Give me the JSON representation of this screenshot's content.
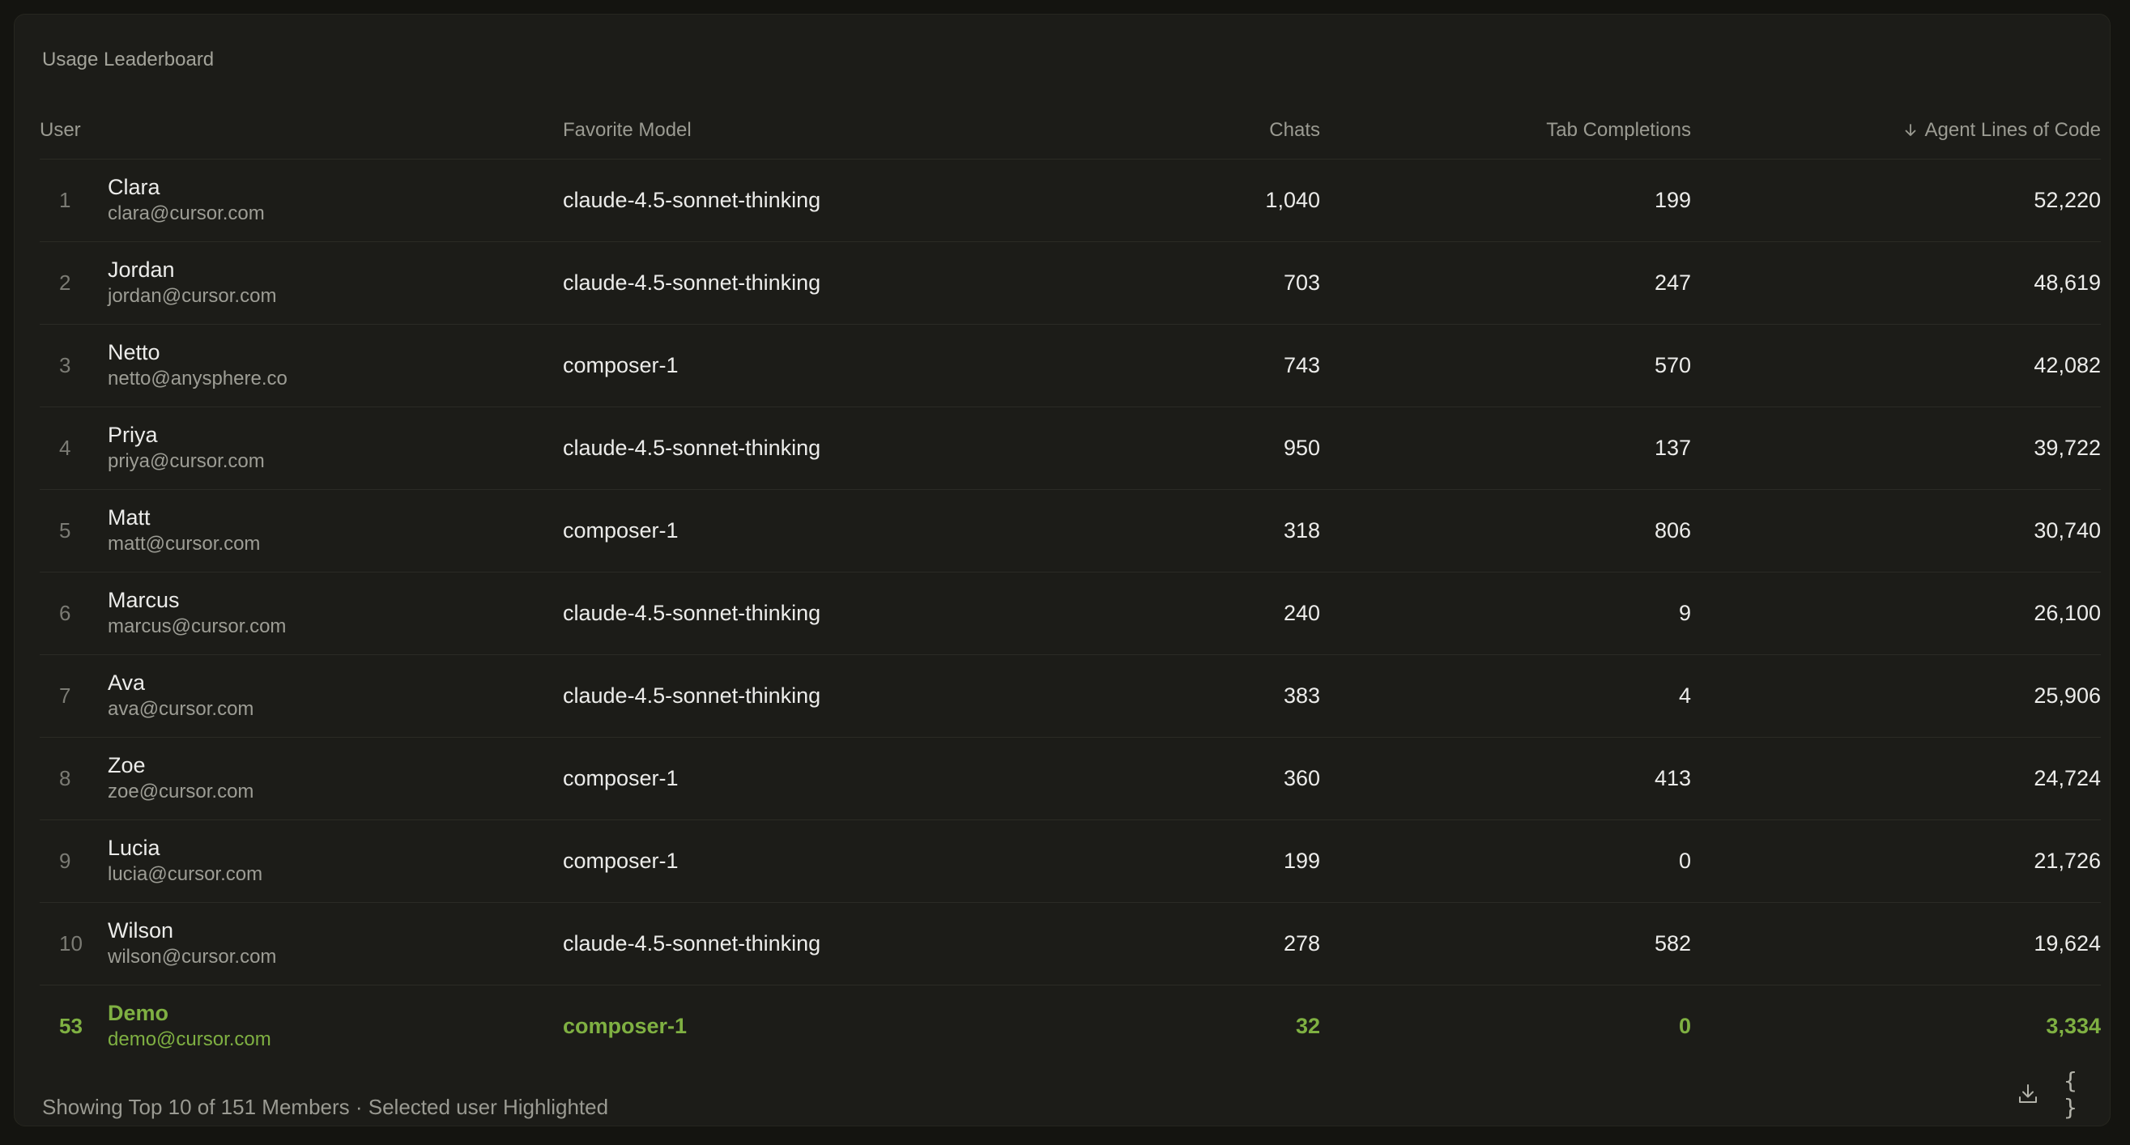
{
  "panel": {
    "title": "Usage Leaderboard"
  },
  "table": {
    "headers": {
      "user": "User",
      "model": "Favorite Model",
      "chats": "Chats",
      "tabs": "Tab Completions",
      "lines": "Agent Lines of Code"
    },
    "sort_icon": "arrow-down-icon",
    "rows": [
      {
        "rank": "1",
        "name": "Clara",
        "email": "clara@cursor.com",
        "model": "claude-4.5-sonnet-thinking",
        "chats": "1,040",
        "tabs": "199",
        "lines": "52,220"
      },
      {
        "rank": "2",
        "name": "Jordan",
        "email": "jordan@cursor.com",
        "model": "claude-4.5-sonnet-thinking",
        "chats": "703",
        "tabs": "247",
        "lines": "48,619"
      },
      {
        "rank": "3",
        "name": "Netto",
        "email": "netto@anysphere.co",
        "model": "composer-1",
        "chats": "743",
        "tabs": "570",
        "lines": "42,082"
      },
      {
        "rank": "4",
        "name": "Priya",
        "email": "priya@cursor.com",
        "model": "claude-4.5-sonnet-thinking",
        "chats": "950",
        "tabs": "137",
        "lines": "39,722"
      },
      {
        "rank": "5",
        "name": "Matt",
        "email": "matt@cursor.com",
        "model": "composer-1",
        "chats": "318",
        "tabs": "806",
        "lines": "30,740"
      },
      {
        "rank": "6",
        "name": "Marcus",
        "email": "marcus@cursor.com",
        "model": "claude-4.5-sonnet-thinking",
        "chats": "240",
        "tabs": "9",
        "lines": "26,100"
      },
      {
        "rank": "7",
        "name": "Ava",
        "email": "ava@cursor.com",
        "model": "claude-4.5-sonnet-thinking",
        "chats": "383",
        "tabs": "4",
        "lines": "25,906"
      },
      {
        "rank": "8",
        "name": "Zoe",
        "email": "zoe@cursor.com",
        "model": "composer-1",
        "chats": "360",
        "tabs": "413",
        "lines": "24,724"
      },
      {
        "rank": "9",
        "name": "Lucia",
        "email": "lucia@cursor.com",
        "model": "composer-1",
        "chats": "199",
        "tabs": "0",
        "lines": "21,726"
      },
      {
        "rank": "10",
        "name": "Wilson",
        "email": "wilson@cursor.com",
        "model": "claude-4.5-sonnet-thinking",
        "chats": "278",
        "tabs": "582",
        "lines": "19,624"
      }
    ],
    "highlighted": {
      "rank": "53",
      "name": "Demo",
      "email": "demo@cursor.com",
      "model": "composer-1",
      "chats": "32",
      "tabs": "0",
      "lines": "3,334"
    }
  },
  "footer": {
    "summary": "Showing Top 10 of 151 Members · Selected user Highlighted",
    "download_icon": "download-icon",
    "json_icon": "code-braces-icon",
    "json_label": "{ }"
  },
  "colors": {
    "highlight": "#7fb042",
    "background": "#141410",
    "panel": "#1c1c18"
  }
}
